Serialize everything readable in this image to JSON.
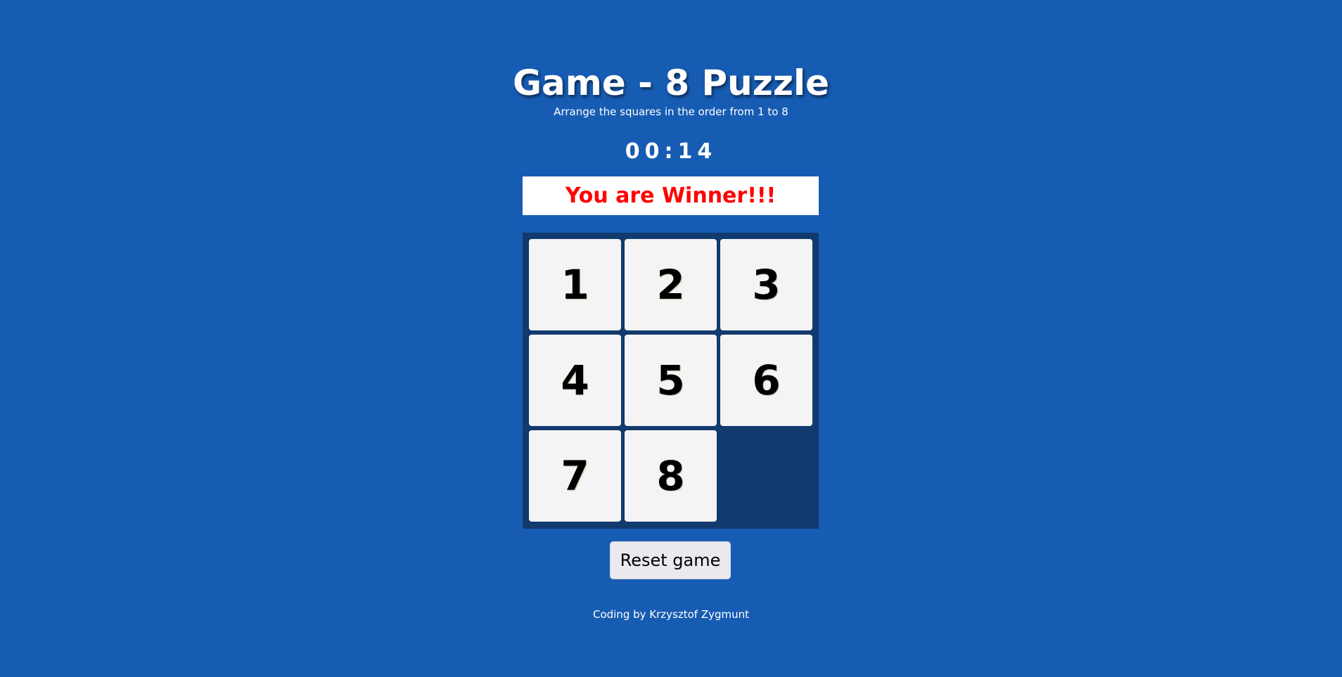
{
  "header": {
    "title": "Game - 8 Puzzle",
    "subtitle": "Arrange the squares in the order from 1 to 8"
  },
  "timer": {
    "value": "00:14"
  },
  "status": {
    "message": "You are Winner!!!"
  },
  "board": {
    "rows": 3,
    "cols": 3,
    "tiles": [
      [
        "1",
        "2",
        "3"
      ],
      [
        "4",
        "5",
        "6"
      ],
      [
        "7",
        "8",
        ""
      ]
    ]
  },
  "controls": {
    "reset_label": "Reset game"
  },
  "footer": {
    "credit": "Coding by Krzysztof Zygmunt"
  },
  "colors": {
    "background": "#175cb3",
    "board_background": "#113a6e",
    "tile": "#f4f4f4",
    "winner_text": "#ff0000"
  }
}
